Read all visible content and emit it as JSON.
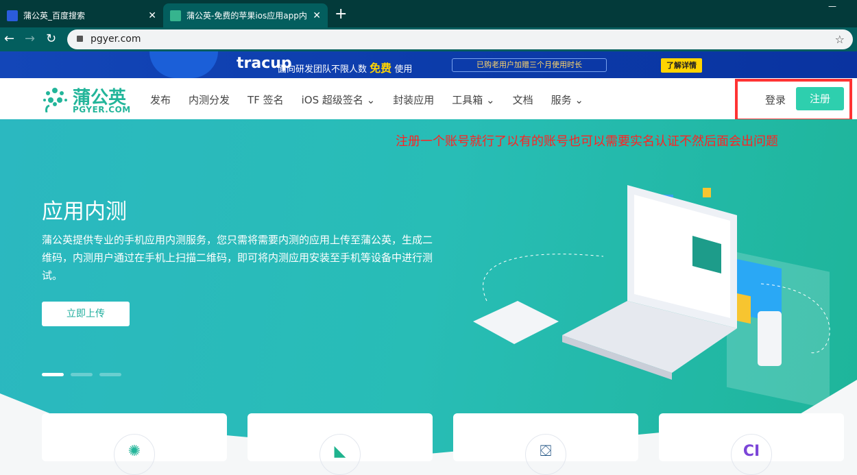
{
  "browser": {
    "tabs": [
      {
        "title": "蒲公英_百度搜索",
        "active": false
      },
      {
        "title": "蒲公英-免费的苹果ios应用app内",
        "active": true
      }
    ],
    "url": "pgyer.com"
  },
  "banner": {
    "brand": "tracup",
    "slogan": "面向研发团队不限人数",
    "highlight": "免费",
    "suffix": "使用",
    "promo": "已购老用户加赠三个月使用时长",
    "cta": "了解详情"
  },
  "header": {
    "logo_cn": "蒲公英",
    "logo_en": "PGYER.COM",
    "menu": [
      "发布",
      "内测分发",
      "TF 签名",
      "iOS 超级签名 ⌄",
      "封装应用",
      "工具箱 ⌄",
      "文档",
      "服务 ⌄"
    ],
    "login": "登录",
    "register": "注册"
  },
  "annotation": "注册一个账号就行了以有的账号也可以需要实名认证不然后面会出问题",
  "hero": {
    "title": "应用内测",
    "desc": "蒲公英提供专业的手机应用内测服务，您只需将需要内测的应用上传至蒲公英，生成二维码，内测用户通过在手机上扫描二维码，即可将内测应用安装至手机等设备中进行测试。",
    "button": "立即上传",
    "slides": 3,
    "active_slide": 0
  },
  "colors": {
    "accent": "#2ecfae",
    "annotation": "#ff2222"
  }
}
